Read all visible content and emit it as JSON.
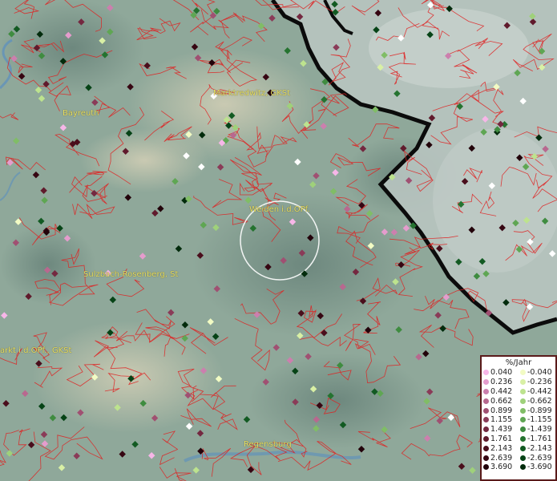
{
  "map": {
    "cities": [
      {
        "name": "Bayreuth"
      },
      {
        "name": "Marktredwitz, GKSt"
      },
      {
        "name": "Weiden i.d.OPf."
      },
      {
        "name": "Sulzbach-Rosenberg, St"
      },
      {
        "name": "arkt i.d.OPf., GKSt"
      },
      {
        "name": "Regensburg"
      }
    ]
  },
  "legend": {
    "title": "%/Jahr",
    "positive": [
      {
        "label": "0.040",
        "color": "#f7b6e8"
      },
      {
        "label": "0.236",
        "color": "#e59ccd"
      },
      {
        "label": "0.442",
        "color": "#cc7fae"
      },
      {
        "label": "0.662",
        "color": "#b8688f"
      },
      {
        "label": "0.899",
        "color": "#a05072"
      },
      {
        "label": "1.155",
        "color": "#8a3b58"
      },
      {
        "label": "1.439",
        "color": "#742840"
      },
      {
        "label": "1.761",
        "color": "#601a2c"
      },
      {
        "label": "2.143",
        "color": "#4a0e1c"
      },
      {
        "label": "2.639",
        "color": "#360612"
      },
      {
        "label": "3.690",
        "color": "#22020a"
      }
    ],
    "negative": [
      {
        "label": "-0.040",
        "color": "#f2fbc4"
      },
      {
        "label": "-0.236",
        "color": "#d9f0a5"
      },
      {
        "label": "-0.442",
        "color": "#bde38e"
      },
      {
        "label": "-0.662",
        "color": "#9fd17a"
      },
      {
        "label": "-0.899",
        "color": "#80bd66"
      },
      {
        "label": "-1.155",
        "color": "#5fa653"
      },
      {
        "label": "-1.439",
        "color": "#3f8c40"
      },
      {
        "label": "-1.761",
        "color": "#257330"
      },
      {
        "label": "-2.143",
        "color": "#125a22"
      },
      {
        "label": "-2.639",
        "color": "#064316"
      },
      {
        "label": "-3.690",
        "color": "#022b0c"
      }
    ]
  }
}
